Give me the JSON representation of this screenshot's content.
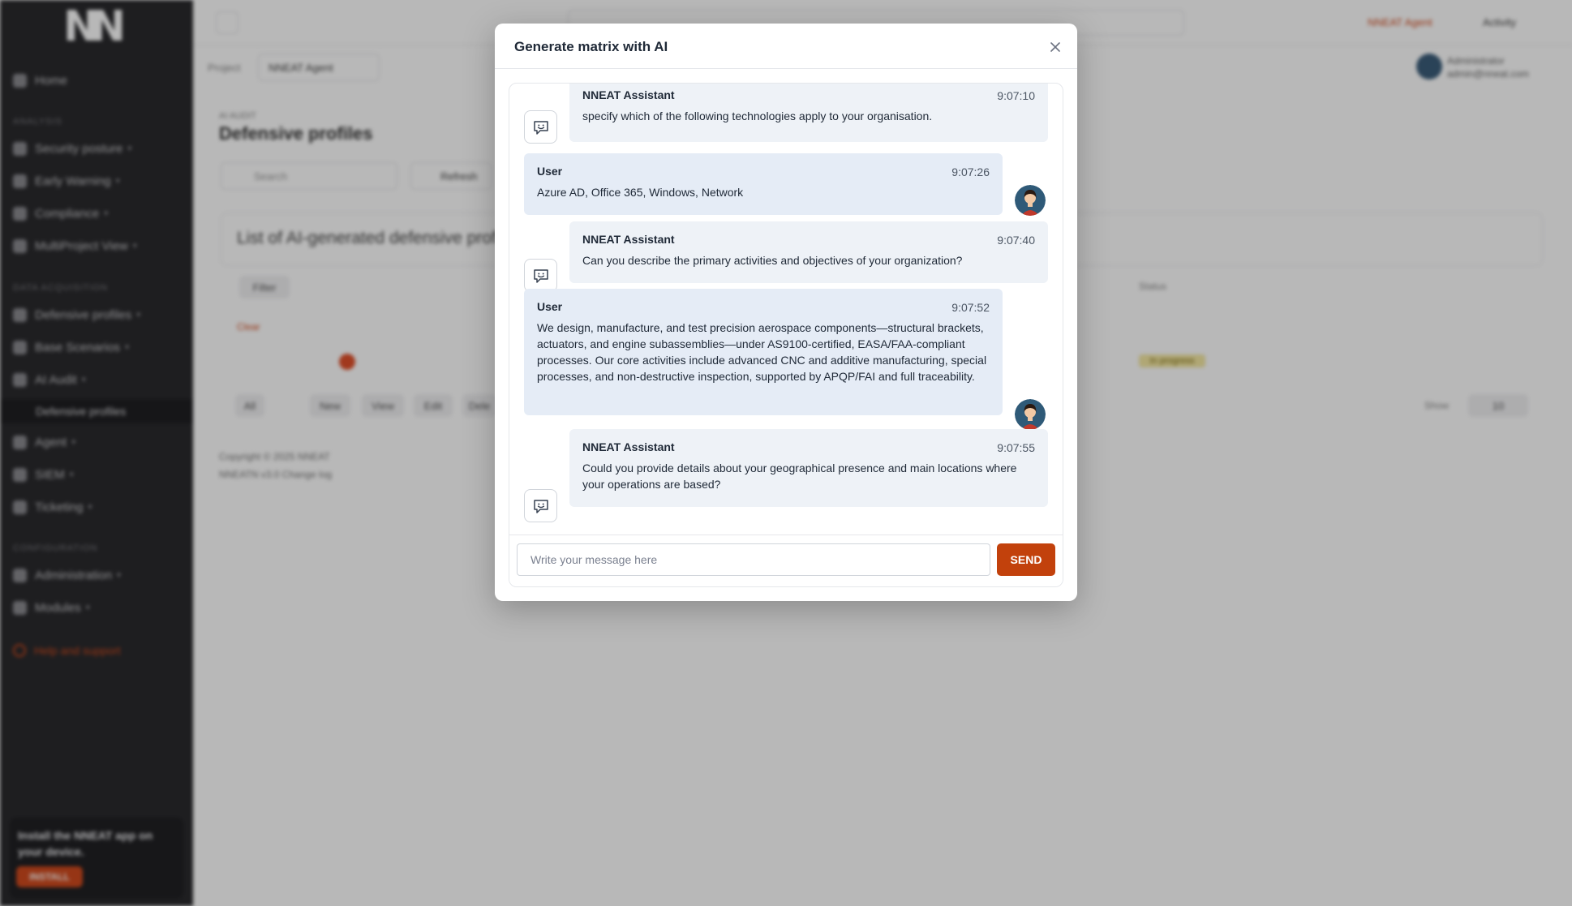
{
  "app": {
    "logo_text": "NN",
    "sidebar": {
      "home": "Home",
      "section_analysis": "Analysis",
      "security_posture": "Security posture",
      "early_warning": "Early Warning",
      "compliance": "Compliance",
      "multiproject_view": "MultiProject View",
      "section_data_acquisition": "Data acquisition",
      "defensive_profiles": "Defensive profiles",
      "base_scenarios": "Base Scenarios",
      "ai_audit": "AI Audit",
      "defensive_profiles_sub": "Defensive profiles",
      "agent": "Agent",
      "siem": "SIEM",
      "ticketing": "Ticketing",
      "section_configuration": "Configuration",
      "administration": "Administration",
      "modules": "Modules",
      "help": "Help and support",
      "install_text": "Install the NNEAT app on your device.",
      "install_button": "INSTALL"
    },
    "topbar": {
      "agent_label": "NNEAT Agent",
      "activity_label": "Activity",
      "project_label": "Project",
      "project_value": "NNEAT Agent",
      "user_name": "Administrator",
      "user_email": "admin@nneat.com"
    },
    "content": {
      "breadcrumb": "AI AUDIT",
      "title": "Defensive profiles",
      "search_placeholder": "Search",
      "refresh_label": "Refresh",
      "panel_title": "List of AI-generated defensive profiles",
      "filter_label": "Filter",
      "clear_label": "Clear",
      "status_header": "Status",
      "status_value": "In progress",
      "pager": [
        "All",
        "New",
        "View",
        "Edit",
        "Dele"
      ],
      "show_label": "Show",
      "show_value": "10",
      "copyright": "Copyright © 2025 NNEAT",
      "version_line": "NNEATN v3.0 Change log"
    }
  },
  "modal": {
    "title": "Generate matrix with AI",
    "messages": [
      {
        "role": "assistant",
        "author": "NNEAT Assistant",
        "time": "9:07:10",
        "text": "specify which of the following technologies apply to your organisation."
      },
      {
        "role": "user",
        "author": "User",
        "time": "9:07:26",
        "text": "Azure AD, Office 365, Windows, Network"
      },
      {
        "role": "assistant",
        "author": "NNEAT Assistant",
        "time": "9:07:40",
        "text": "Can you describe the primary activities and objectives of your organization?"
      },
      {
        "role": "user",
        "author": "User",
        "time": "9:07:52",
        "text": "We design, manufacture, and test precision aerospace components—structural brackets, actuators, and engine subassemblies—under AS9100-certified, EASA/FAA-compliant processes. Our core activities include advanced CNC and additive manufacturing, special processes, and non-destructive inspection, supported by APQP/FAI and full traceability."
      },
      {
        "role": "assistant",
        "author": "NNEAT Assistant",
        "time": "9:07:55",
        "text": "Could you provide details about your geographical presence and main locations where your operations are based?"
      }
    ],
    "input_placeholder": "Write your message here",
    "input_value": "",
    "send_label": "SEND"
  },
  "colors": {
    "accent": "#c2410c",
    "assistant_bubble": "#eef2f7",
    "user_bubble": "#e5ecf6",
    "sidebar_bg": "#2a2a2d"
  },
  "icons": {
    "close": "close-icon",
    "assistant": "chat-bot-icon",
    "user": "user-avatar"
  }
}
